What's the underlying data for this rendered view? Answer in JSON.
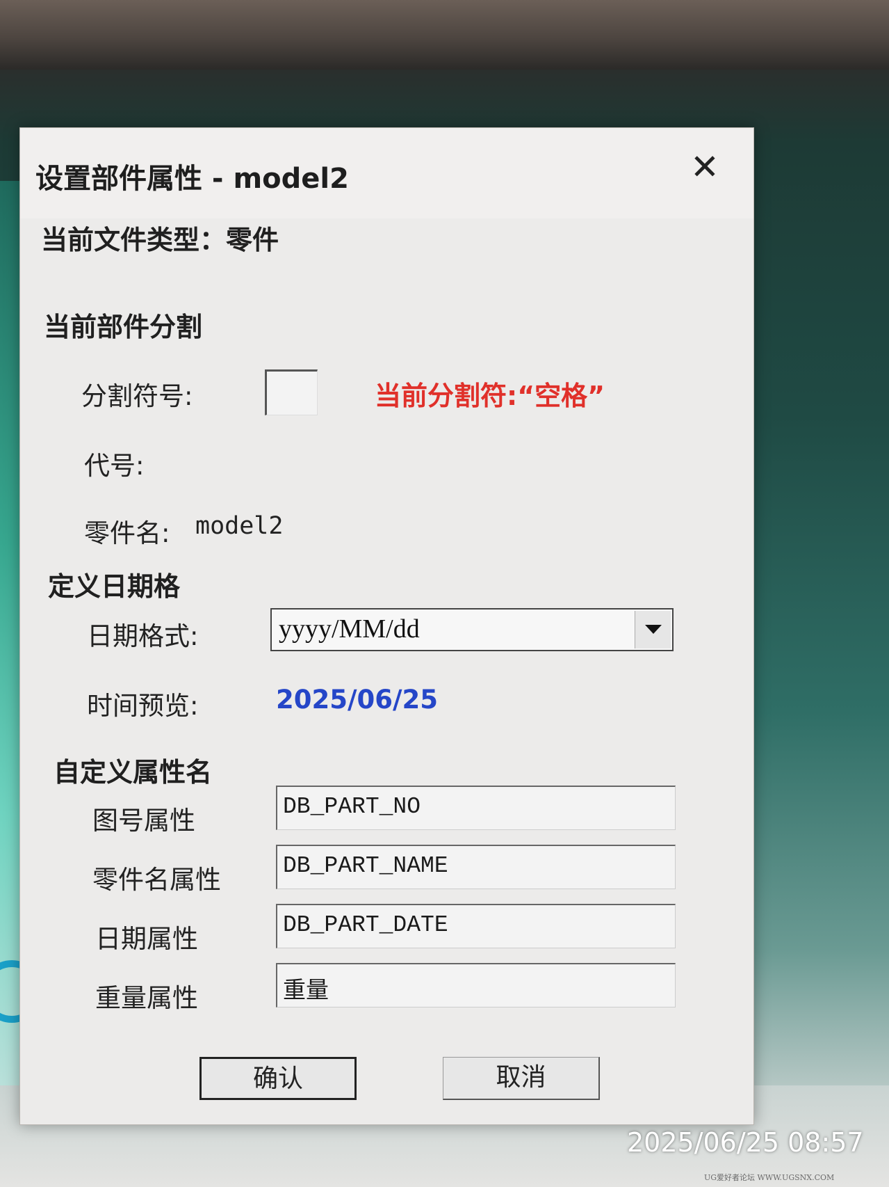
{
  "dialog": {
    "title": "设置部件属性 - model2",
    "close_glyph": "✕",
    "file_type": "当前文件类型：零件",
    "split_section": {
      "heading": "当前部件分割",
      "separator_label": "分割符号:",
      "separator_value": "",
      "current_separator_note": "当前分割符:“空格”",
      "code_label": "代号:",
      "part_name_label": "零件名:",
      "part_name_value": "model2"
    },
    "date_section": {
      "heading": "定义日期格",
      "format_label": "日期格式:",
      "format_value": "yyyy/MM/dd",
      "preview_label": "时间预览:",
      "preview_value": "2025/06/25"
    },
    "custom_section": {
      "heading": "自定义属性名",
      "fields": [
        {
          "label": "图号属性",
          "value": "DB_PART_NO"
        },
        {
          "label": "零件名属性",
          "value": "DB_PART_NAME"
        },
        {
          "label": "日期属性",
          "value": "DB_PART_DATE"
        },
        {
          "label": "重量属性",
          "value": "重量"
        }
      ]
    },
    "buttons": {
      "ok": "确认",
      "cancel": "取消"
    }
  },
  "photo_timestamp": "2025/06/25 08:57",
  "watermark": "UG爱好者论坛 WWW.UGSNX.COM"
}
